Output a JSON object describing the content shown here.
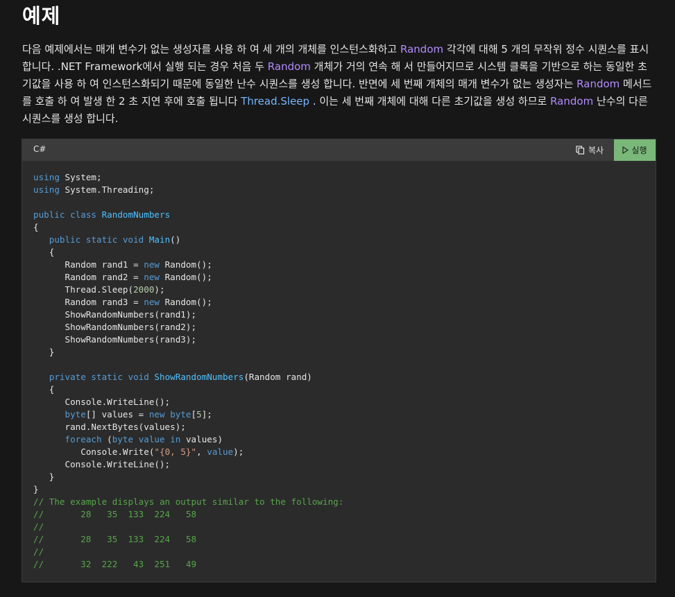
{
  "heading": "예제",
  "paragraph": {
    "p1": "다음 예제에서는 매개 변수가 없는 생성자를 사용 하 여 세 개의 개체를 인스턴스화하고 ",
    "link1": "Random",
    "p2": " 각각에 대해 5 개의 무작위 정수 시퀀스를 표시 합니다. .NET Framework에서 실행 되는 경우 처음 두 ",
    "link2": "Random",
    "p3": " 개체가 거의 연속 해 서 만들어지므로 시스템 클록을 기반으로 하는 동일한 초기값을 사용 하 여 인스턴스화되기 때문에 동일한 난수 시퀀스를 생성 합니다. 반면에 세 번째 개체의 매개 변수가 없는 생성자는 ",
    "link3": "Random",
    "p4": " 메서드를 호출 하 여 발생 한 2 초 지연 후에 호출 됩니다 ",
    "link4": "Thread.Sleep",
    "p5": " . 이는 세 번째 개체에 대해 다른 초기값을 생성 하므로 ",
    "link5": "Random",
    "p6": " 난수의 다른 시퀀스를 생성 합니다."
  },
  "code_block": {
    "language": "C#",
    "copy_label": "복사",
    "run_label": "실행",
    "lines": {
      "l1_kw": "using",
      "l1_rest": " System;",
      "l2_kw": "using",
      "l2_rest": " System.Threading;",
      "l4_kw": "public class",
      "l4_ty": "RandomNumbers",
      "l5": "{",
      "l6_kw": "public static void",
      "l6_fn": "Main",
      "l6_rest": "()",
      "l7": "{",
      "l8_a": "Random rand1 = ",
      "l8_kw": "new",
      "l8_b": " Random();",
      "l9_a": "Random rand2 = ",
      "l9_kw": "new",
      "l9_b": " Random();",
      "l10_a": "Thread.Sleep(",
      "l10_nm": "2000",
      "l10_b": ");",
      "l11_a": "Random rand3 = ",
      "l11_kw": "new",
      "l11_b": " Random();",
      "l12": "ShowRandomNumbers(rand1);",
      "l13": "ShowRandomNumbers(rand2);",
      "l14": "ShowRandomNumbers(rand3);",
      "l15": "}",
      "l17_kw": "private static void",
      "l17_fn": "ShowRandomNumbers",
      "l17_rest": "(Random rand)",
      "l18": "{",
      "l19": "Console.WriteLine();",
      "l20_kw1": "byte",
      "l20_a": "[] values = ",
      "l20_kw2": "new",
      "l20_kw3": "byte",
      "l20_b": "[",
      "l20_nm": "5",
      "l20_c": "];",
      "l21": "rand.NextBytes(values);",
      "l22_kw1": "foreach",
      "l22_a": " (",
      "l22_kw2": "byte",
      "l22_sp": " ",
      "l22_kw3": "value",
      "l22_sp2": " ",
      "l22_kw4": "in",
      "l22_b": " values)",
      "l23_a": "Console.Write(",
      "l23_st": "\"{0, 5}\"",
      "l23_b": ", ",
      "l23_kw": "value",
      "l23_c": ");",
      "l24": "Console.WriteLine();",
      "l25": "}",
      "l26": "}",
      "c1": "// The example displays an output similar to the following:",
      "c2": "//       28   35  133  224   58",
      "c3": "//",
      "c4": "//       28   35  133  224   58",
      "c5": "//",
      "c6": "//       32  222   43  251   49"
    }
  }
}
